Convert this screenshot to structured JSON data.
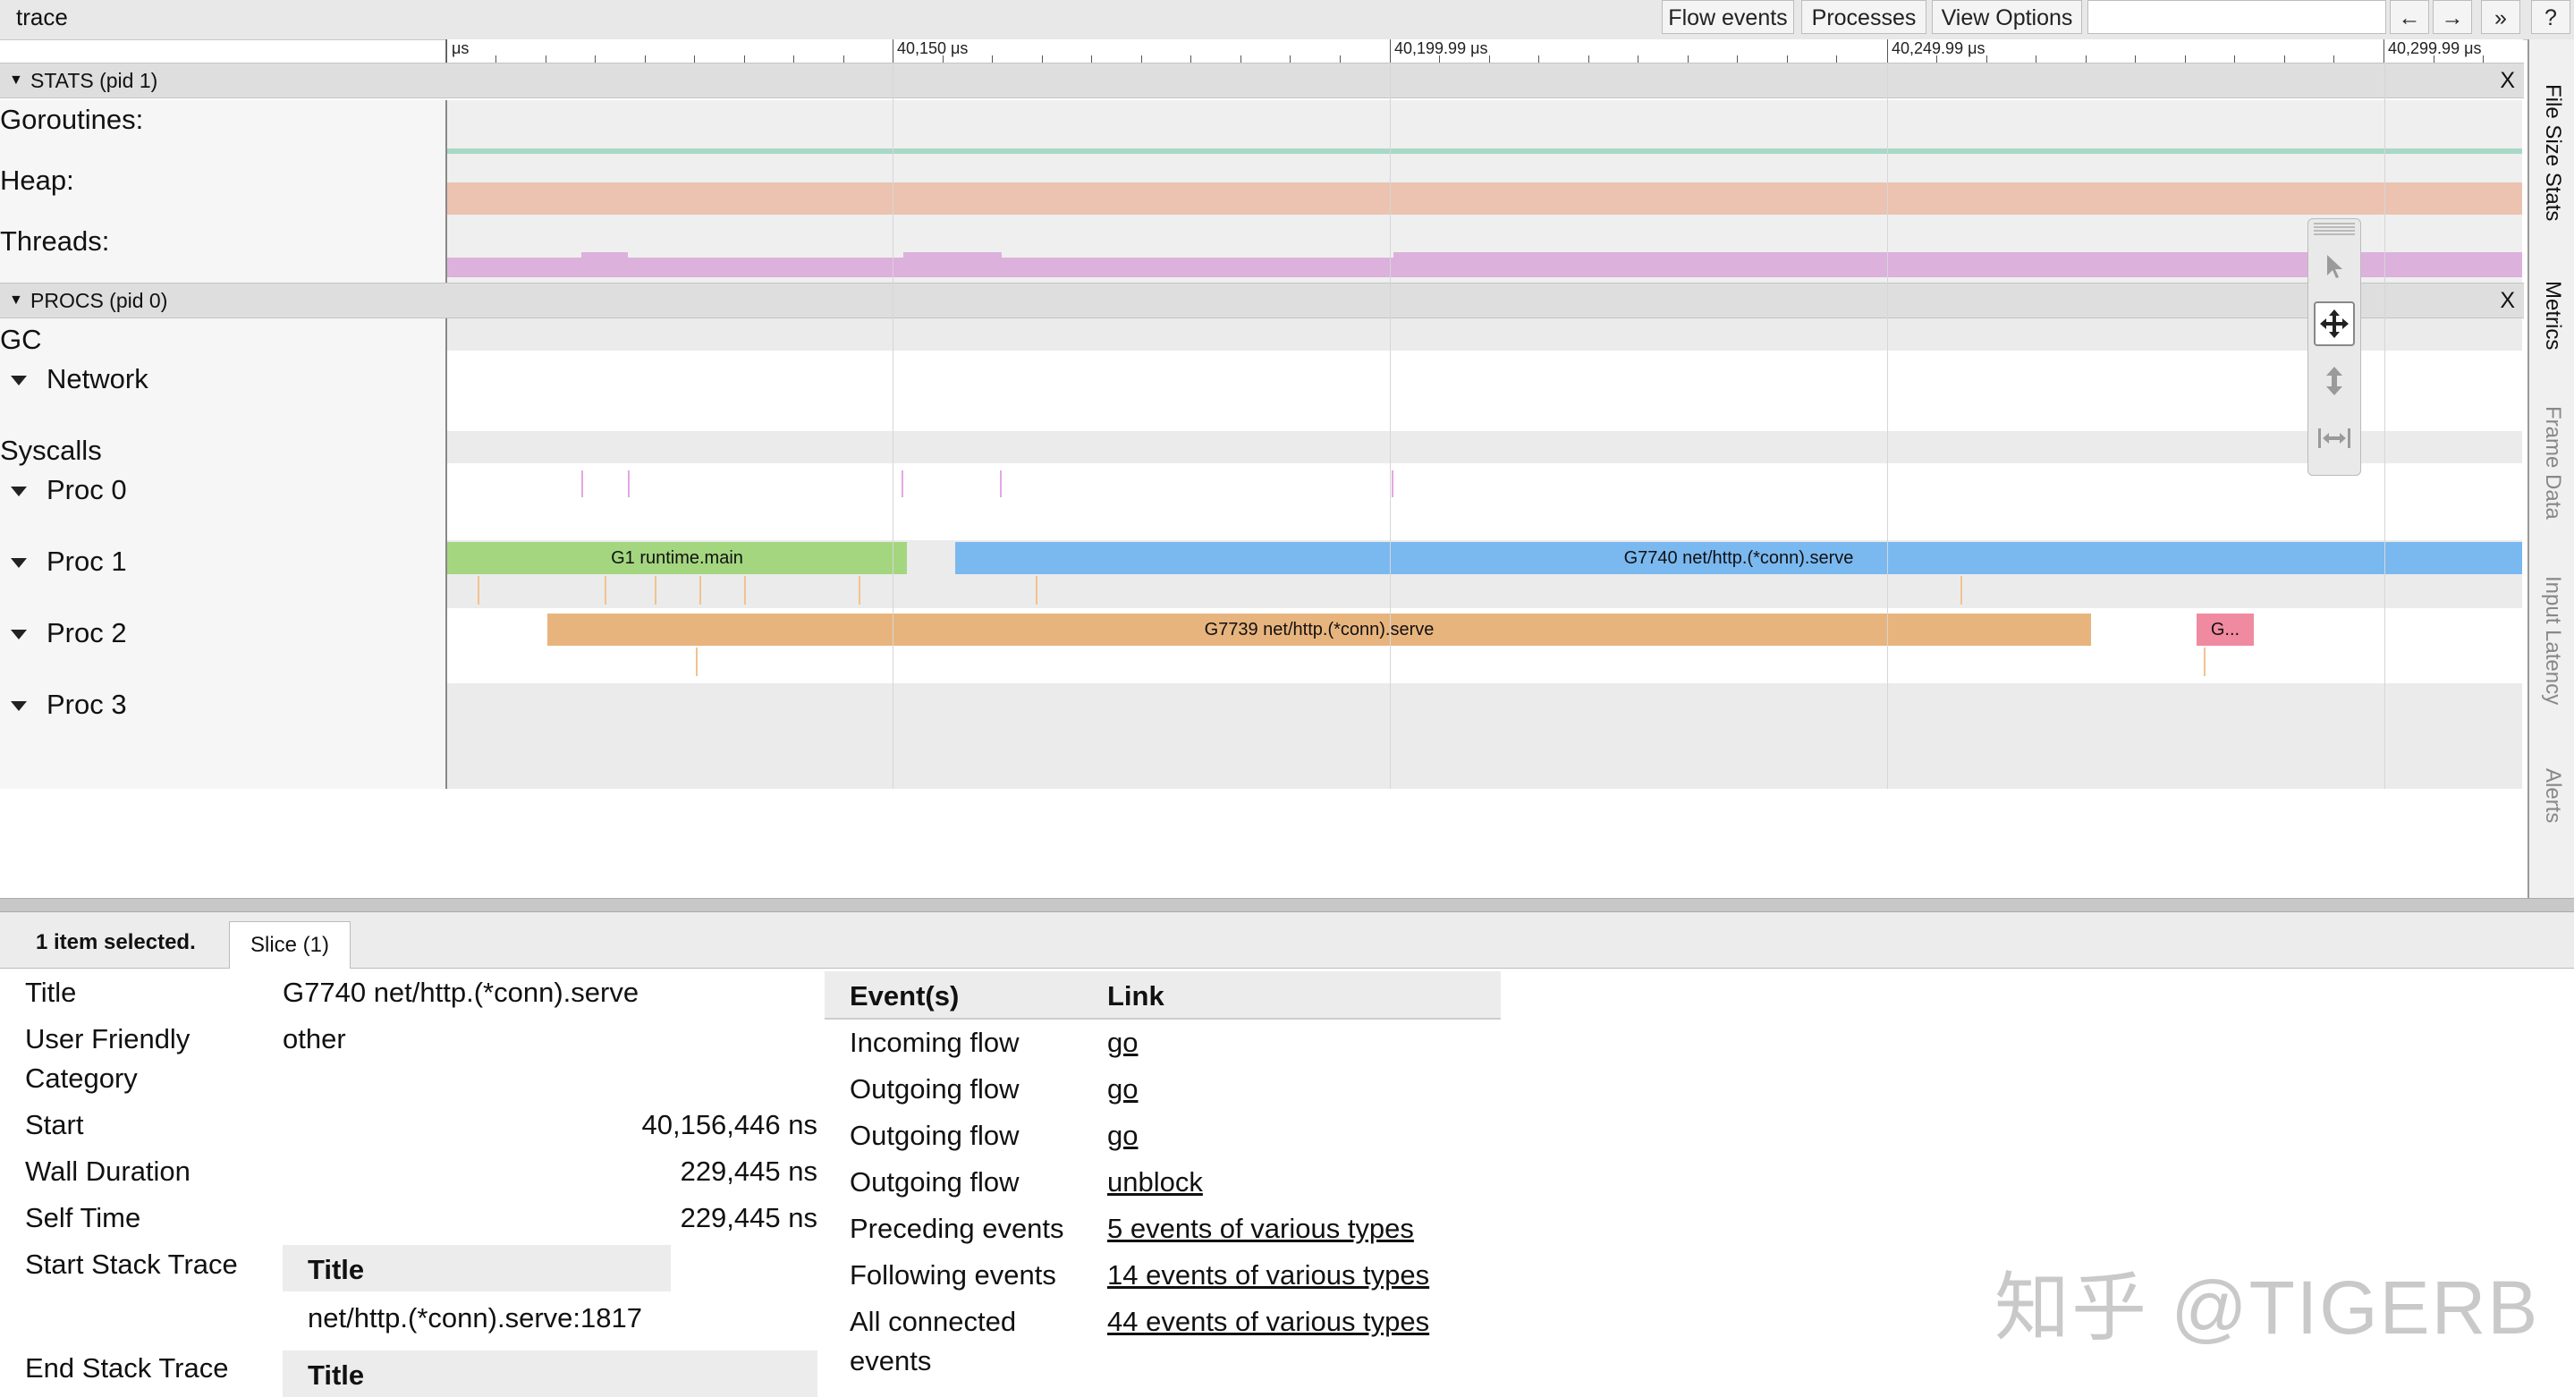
{
  "app": {
    "title": "trace"
  },
  "toolbar": {
    "flow_events": "Flow events",
    "processes": "Processes",
    "view_options": "View Options",
    "search_value": "",
    "back": "←",
    "forward": "→",
    "more": "»",
    "help": "?"
  },
  "ruler": {
    "labels": [
      "μs",
      "40,150 μs",
      "40,199.99 μs",
      "40,249.99 μs",
      "40,299.99 μs"
    ]
  },
  "stats": {
    "header": "STATS (pid 1)",
    "close": "X",
    "rows": [
      "Goroutines:",
      "Heap:",
      "Threads:"
    ]
  },
  "procs": {
    "header": "PROCS (pid 0)",
    "close": "X",
    "rows": [
      "GC",
      "Network",
      "Syscalls",
      "Proc 0",
      "Proc 1",
      "Proc 2",
      "Proc 3"
    ],
    "slices": {
      "g1_main": "G1 runtime.main",
      "g7740": "G7740 net/http.(*conn).serve",
      "g7739": "G7739 net/http.(*conn).serve",
      "g_small": "G..."
    }
  },
  "side_tabs": [
    "File Size Stats",
    "Metrics",
    "Frame Data",
    "Input Latency",
    "Alerts"
  ],
  "colors": {
    "goroutines": "#a8d8c6",
    "heap": "#ebc3b0",
    "threads": "#dcb1dc",
    "g1": "#a4d680",
    "g7740": "#7ab8f0",
    "g7739": "#e8b47e",
    "gsmall": "#f08aa0"
  },
  "analysis": {
    "selected": "1 item selected.",
    "tab": "Slice (1)",
    "props": {
      "title_label": "Title",
      "title_value": "G7740 net/http.(*conn).serve",
      "ufc_label_1": "User Friendly",
      "ufc_label_2": "Category",
      "ufc_value": "other",
      "start_label": "Start",
      "start_value": "40,156,446 ns",
      "wall_label": "Wall Duration",
      "wall_value": "229,445 ns",
      "self_label": "Self Time",
      "self_value": "229,445 ns",
      "start_stack_label": "Start Stack Trace",
      "stack_header": "Title",
      "stack_frame": "net/http.(*conn).serve:1817",
      "end_stack_label": "End Stack Trace",
      "end_stack_header": "Title"
    },
    "flows": {
      "col_events": "Event(s)",
      "col_link": "Link",
      "rows": [
        {
          "event": "Incoming flow",
          "link": "go"
        },
        {
          "event": "Outgoing flow",
          "link": "go"
        },
        {
          "event": "Outgoing flow",
          "link": "go"
        },
        {
          "event": "Outgoing flow",
          "link": "unblock"
        },
        {
          "event": "Preceding events",
          "link": "5 events of various types"
        },
        {
          "event": "Following events",
          "link": "14 events of various types"
        },
        {
          "event": "All connected",
          "event2": "events",
          "link": "44 events of various types"
        }
      ]
    }
  },
  "watermark": "知乎 @TIGERB"
}
